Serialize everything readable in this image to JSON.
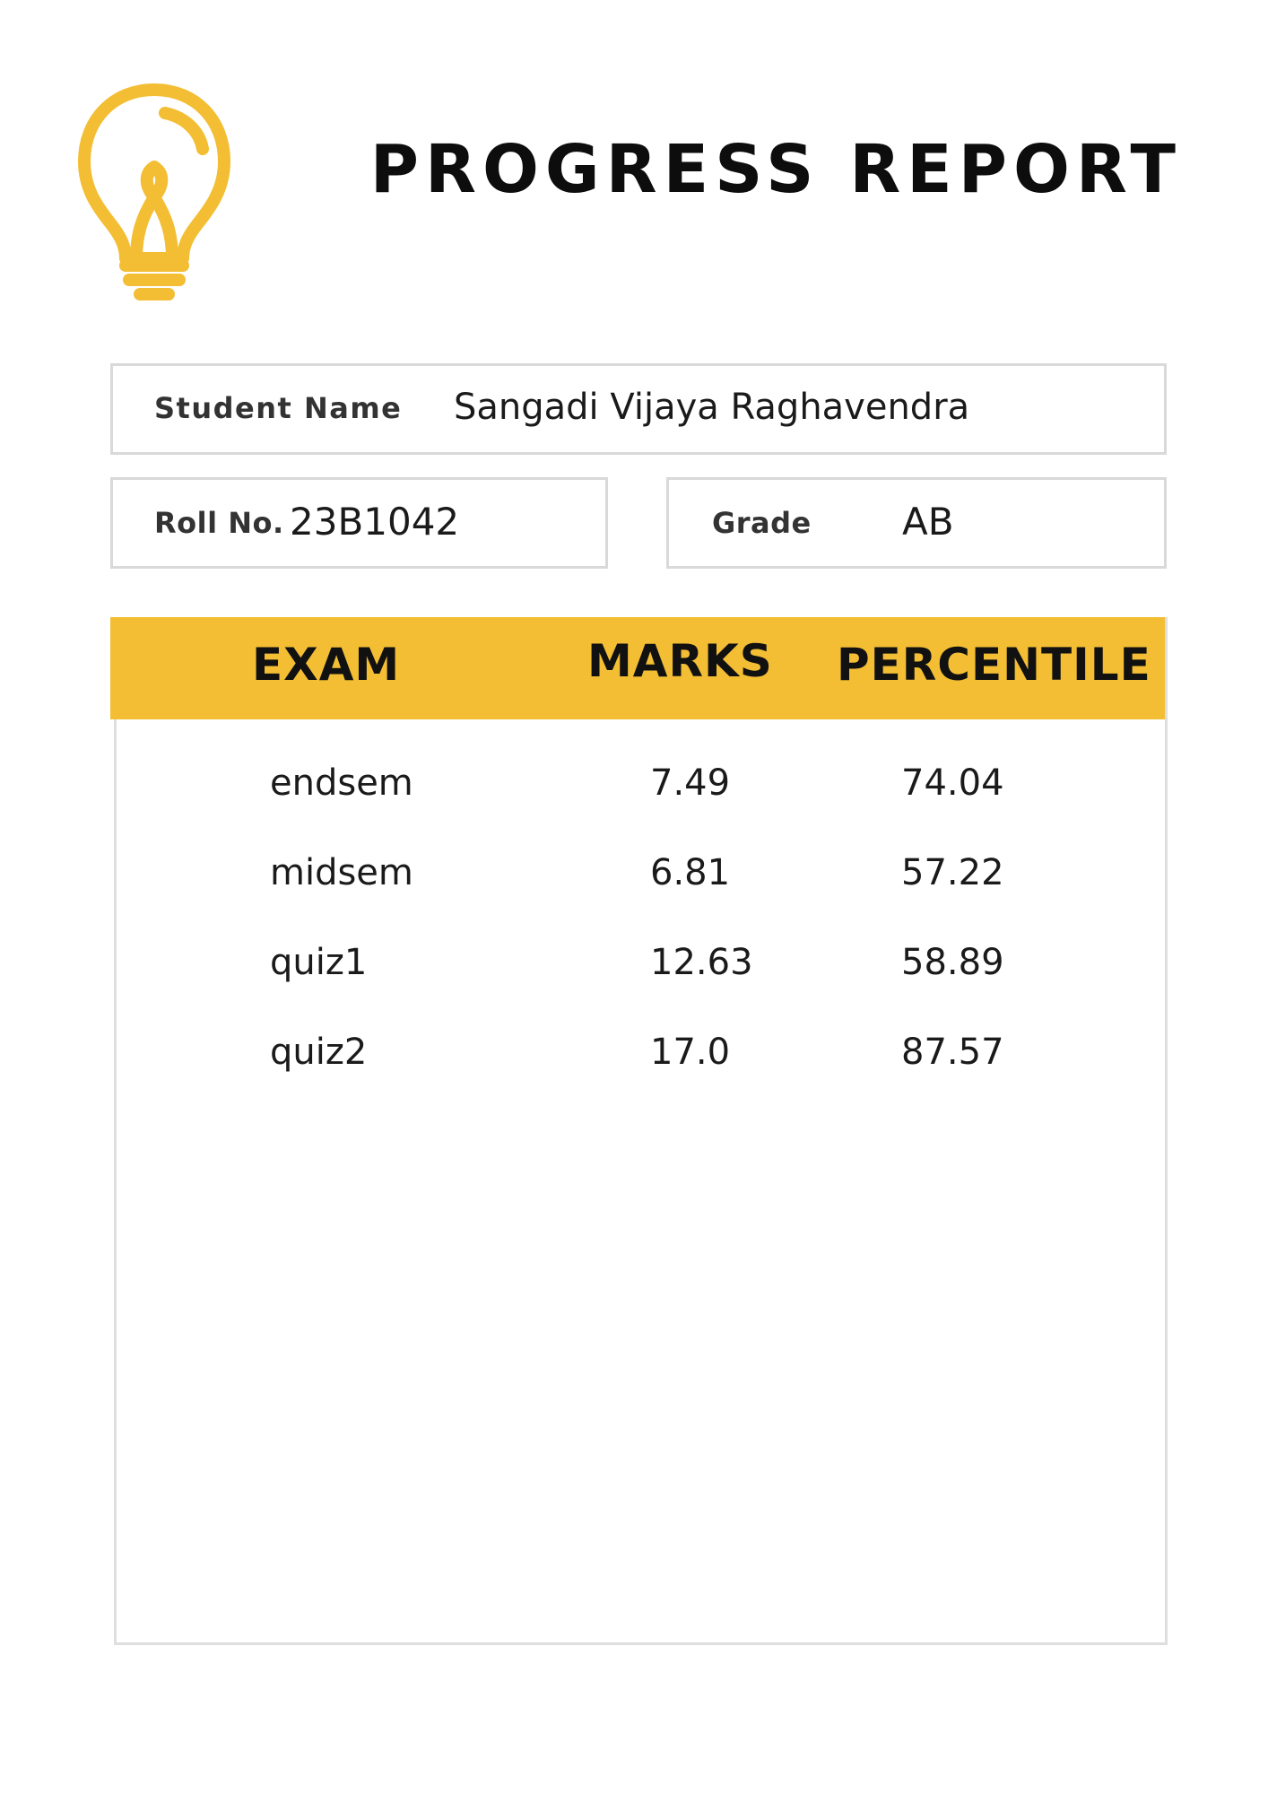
{
  "title": "PROGRESS REPORT",
  "icon": "lightbulb-icon",
  "colors": {
    "accent": "#f3be33",
    "border": "#d9d9d9",
    "text": "#111111"
  },
  "student": {
    "name_label": "Student Name",
    "name_value": "Sangadi Vijaya Raghavendra",
    "roll_label": "Roll No.",
    "roll_value": "23B1042",
    "grade_label": "Grade",
    "grade_value": "AB"
  },
  "table": {
    "headers": [
      "EXAM",
      "MARKS",
      "PERCENTILE"
    ],
    "rows": [
      {
        "exam": "endsem",
        "marks": "7.49",
        "percentile": "74.04"
      },
      {
        "exam": "midsem",
        "marks": "6.81",
        "percentile": "57.22"
      },
      {
        "exam": "quiz1",
        "marks": "12.63",
        "percentile": "58.89"
      },
      {
        "exam": "quiz2",
        "marks": "17.0",
        "percentile": "87.57"
      }
    ]
  }
}
